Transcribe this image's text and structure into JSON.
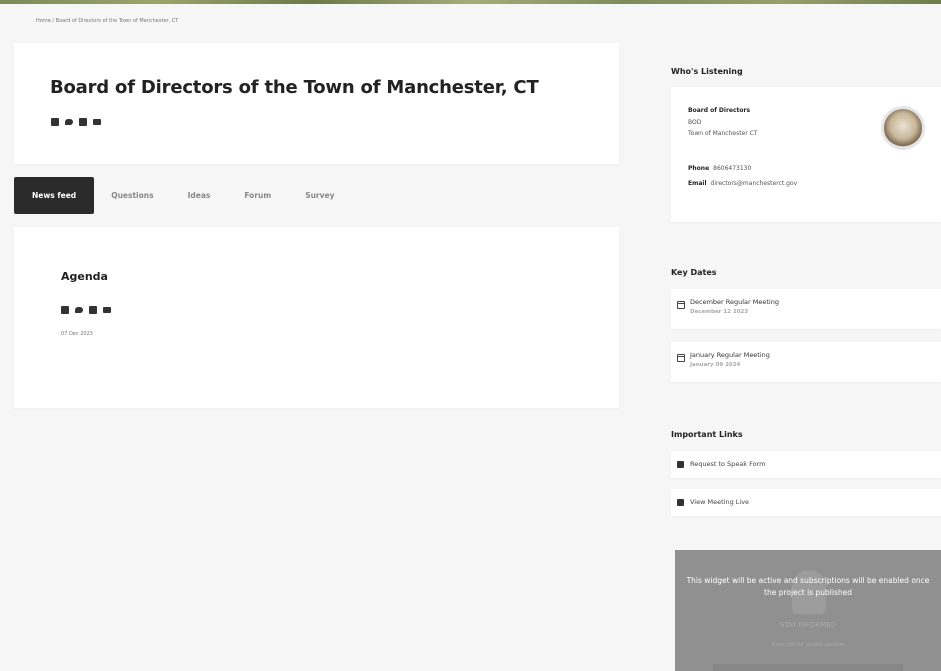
{
  "breadcrumb": {
    "home": "Home",
    "separator": "/",
    "current": "Board of Directors of the Town of Manchester, CT"
  },
  "page": {
    "title": "Board of Directors of the Town of Manchester, CT"
  },
  "share_icons": [
    "facebook-icon",
    "twitter-icon",
    "linkedin-icon",
    "email-icon"
  ],
  "tabs": [
    {
      "label": "News feed",
      "active": true
    },
    {
      "label": "Questions"
    },
    {
      "label": "Ideas"
    },
    {
      "label": "Forum"
    },
    {
      "label": "Survey"
    }
  ],
  "feed": {
    "title": "Agenda",
    "date": "07 Dec 2023"
  },
  "listening": {
    "section_title": "Who's Listening",
    "name": "Board of Directors",
    "abbrev": "BOD",
    "org": "Town of Manchester CT",
    "phone_label": "Phone",
    "phone": "8606473130",
    "email_label": "Email",
    "email": "directors@manchesterct.gov"
  },
  "key_dates": {
    "section_title": "Key Dates",
    "items": [
      {
        "title": "December Regular Meeting",
        "date": "December 12 2023"
      },
      {
        "title": "January Regular Meeting",
        "date": "January 09 2024"
      }
    ]
  },
  "links": {
    "section_title": "Important Links",
    "items": [
      {
        "label": "Request to Speak Form"
      },
      {
        "label": "View Meeting Live"
      }
    ]
  },
  "widget": {
    "message": "This widget will be active and subscriptions will be enabled once the project is published",
    "stay": "STAY INFORMED",
    "sub": "Subscribe for project updates"
  },
  "colors": {
    "tab_active_bg": "#2b2b2b",
    "page_bg": "#f6f6f6",
    "widget_bg": "#909090"
  }
}
